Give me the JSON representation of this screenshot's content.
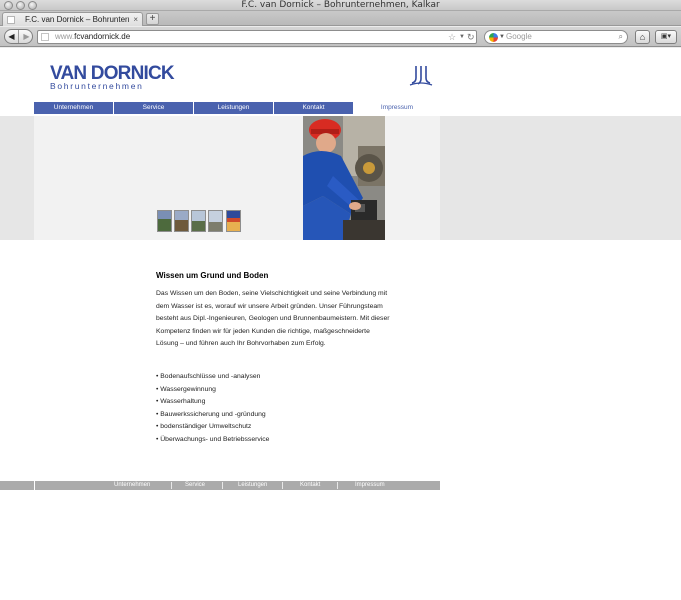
{
  "browser": {
    "window_title": "F.C. van Dornick – Bohrunternehmen, Kalkar",
    "tab_title": "F.C. van Dornick – Bohrunterneh...",
    "url_protocol": "www.",
    "url_domain": "fcvandornick.de",
    "search_placeholder": "Google",
    "new_tab_label": "+",
    "icons": [
      "back-icon",
      "forward-icon",
      "star-icon",
      "reload-icon",
      "google-icon",
      "search-icon",
      "home-icon",
      "bookmarks-icon"
    ]
  },
  "site": {
    "logo_main": "VAN DORNICK",
    "logo_sub": "Bohrunternehmen",
    "brand_color": "#334b9e",
    "nav_color": "#4a62ae"
  },
  "nav": {
    "items": [
      "Unternehmen",
      "Service",
      "Leistungen",
      "Kontakt",
      "Impressum"
    ]
  },
  "content": {
    "heading": "Wissen um Grund und Boden",
    "paragraph": "Das Wissen um den Boden, seine Vielschichtigkeit und seine Verbindung mit dem Wasser ist es, worauf wir unsere Arbeit gründen. Unser Führungsteam besteht aus Dipl.-Ingenieuren, Geologen und Brunnenbaumeistern. Mit dieser Kompetenz finden wir für jeden Kunden die richtige, maßgeschneiderte Lösung – und führen auch Ihr Bohrvorhaben zum Erfolg.",
    "bullets": [
      "• Bodenaufschlüsse und -analysen",
      "• Wassergewinnung",
      "• Wasserhaltung",
      "• Bauwerkssicherung und -gründung",
      "• bodenständiger Umweltschutz",
      "• Überwachungs- und Betriebsservice"
    ]
  },
  "footer": {
    "items": [
      "Unternehmen",
      "Service",
      "Leistungen",
      "Kontakt",
      "Impressum"
    ]
  }
}
